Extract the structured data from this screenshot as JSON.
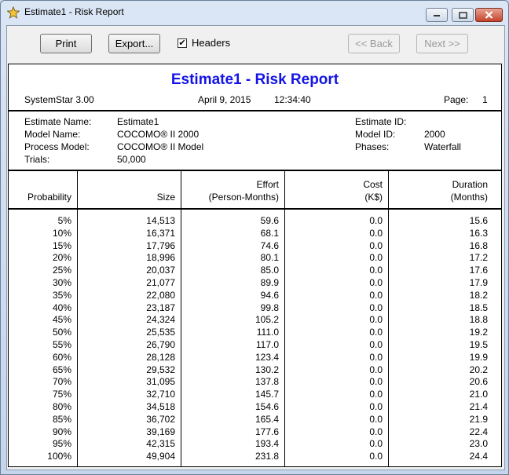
{
  "window": {
    "title": "Estimate1 - Risk Report",
    "icon": "star-icon"
  },
  "toolbar": {
    "print_label": "Print",
    "export_label": "Export...",
    "headers_label": "Headers",
    "headers_checked": true,
    "back_label": "<< Back",
    "next_label": "Next >>"
  },
  "report": {
    "title": "Estimate1 - Risk Report",
    "product": "SystemStar 3.00",
    "date": "April 9, 2015",
    "time": "12:34:40",
    "page_label": "Page:",
    "page_number": "1",
    "info": {
      "estimate_name_label": "Estimate Name:",
      "estimate_name": "Estimate1",
      "model_name_label": "Model Name:",
      "model_name": "COCOMO® II 2000",
      "process_model_label": "Process Model:",
      "process_model": "COCOMO® II Model",
      "trials_label": "Trials:",
      "trials": "50,000",
      "estimate_id_label": "Estimate ID:",
      "estimate_id": "",
      "model_id_label": "Model ID:",
      "model_id": "2000",
      "phases_label": "Phases:",
      "phases": "Waterfall"
    },
    "columns": {
      "probability": "Probability",
      "size": "Size",
      "effort_1": "Effort",
      "effort_2": "(Person-Months)",
      "cost_1": "Cost",
      "cost_2": "(K$)",
      "duration_1": "Duration",
      "duration_2": "(Months)"
    },
    "rows": [
      [
        "5%",
        "14,513",
        "59.6",
        "0.0",
        "15.6"
      ],
      [
        "10%",
        "16,371",
        "68.1",
        "0.0",
        "16.3"
      ],
      [
        "15%",
        "17,796",
        "74.6",
        "0.0",
        "16.8"
      ],
      [
        "20%",
        "18,996",
        "80.1",
        "0.0",
        "17.2"
      ],
      [
        "25%",
        "20,037",
        "85.0",
        "0.0",
        "17.6"
      ],
      [
        "30%",
        "21,077",
        "89.9",
        "0.0",
        "17.9"
      ],
      [
        "35%",
        "22,080",
        "94.6",
        "0.0",
        "18.2"
      ],
      [
        "40%",
        "23,187",
        "99.8",
        "0.0",
        "18.5"
      ],
      [
        "45%",
        "24,324",
        "105.2",
        "0.0",
        "18.8"
      ],
      [
        "50%",
        "25,535",
        "111.0",
        "0.0",
        "19.2"
      ],
      [
        "55%",
        "26,790",
        "117.0",
        "0.0",
        "19.5"
      ],
      [
        "60%",
        "28,128",
        "123.4",
        "0.0",
        "19.9"
      ],
      [
        "65%",
        "29,532",
        "130.2",
        "0.0",
        "20.2"
      ],
      [
        "70%",
        "31,095",
        "137.8",
        "0.0",
        "20.6"
      ],
      [
        "75%",
        "32,710",
        "145.7",
        "0.0",
        "21.0"
      ],
      [
        "80%",
        "34,518",
        "154.6",
        "0.0",
        "21.4"
      ],
      [
        "85%",
        "36,702",
        "165.4",
        "0.0",
        "21.9"
      ],
      [
        "90%",
        "39,169",
        "177.6",
        "0.0",
        "22.4"
      ],
      [
        "95%",
        "42,315",
        "193.4",
        "0.0",
        "23.0"
      ],
      [
        "100%",
        "49,904",
        "231.8",
        "0.0",
        "24.4"
      ]
    ]
  }
}
